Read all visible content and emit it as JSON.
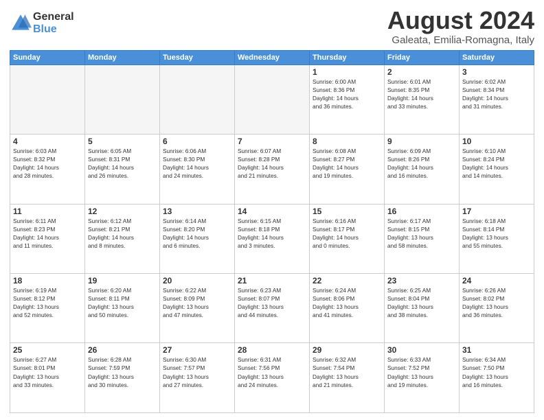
{
  "header": {
    "logo": {
      "general": "General",
      "blue": "Blue"
    },
    "title": "August 2024",
    "location": "Galeata, Emilia-Romagna, Italy"
  },
  "weekdays": [
    "Sunday",
    "Monday",
    "Tuesday",
    "Wednesday",
    "Thursday",
    "Friday",
    "Saturday"
  ],
  "weeks": [
    [
      {
        "day": "",
        "info": ""
      },
      {
        "day": "",
        "info": ""
      },
      {
        "day": "",
        "info": ""
      },
      {
        "day": "",
        "info": ""
      },
      {
        "day": "1",
        "info": "Sunrise: 6:00 AM\nSunset: 8:36 PM\nDaylight: 14 hours\nand 36 minutes."
      },
      {
        "day": "2",
        "info": "Sunrise: 6:01 AM\nSunset: 8:35 PM\nDaylight: 14 hours\nand 33 minutes."
      },
      {
        "day": "3",
        "info": "Sunrise: 6:02 AM\nSunset: 8:34 PM\nDaylight: 14 hours\nand 31 minutes."
      }
    ],
    [
      {
        "day": "4",
        "info": "Sunrise: 6:03 AM\nSunset: 8:32 PM\nDaylight: 14 hours\nand 28 minutes."
      },
      {
        "day": "5",
        "info": "Sunrise: 6:05 AM\nSunset: 8:31 PM\nDaylight: 14 hours\nand 26 minutes."
      },
      {
        "day": "6",
        "info": "Sunrise: 6:06 AM\nSunset: 8:30 PM\nDaylight: 14 hours\nand 24 minutes."
      },
      {
        "day": "7",
        "info": "Sunrise: 6:07 AM\nSunset: 8:28 PM\nDaylight: 14 hours\nand 21 minutes."
      },
      {
        "day": "8",
        "info": "Sunrise: 6:08 AM\nSunset: 8:27 PM\nDaylight: 14 hours\nand 19 minutes."
      },
      {
        "day": "9",
        "info": "Sunrise: 6:09 AM\nSunset: 8:26 PM\nDaylight: 14 hours\nand 16 minutes."
      },
      {
        "day": "10",
        "info": "Sunrise: 6:10 AM\nSunset: 8:24 PM\nDaylight: 14 hours\nand 14 minutes."
      }
    ],
    [
      {
        "day": "11",
        "info": "Sunrise: 6:11 AM\nSunset: 8:23 PM\nDaylight: 14 hours\nand 11 minutes."
      },
      {
        "day": "12",
        "info": "Sunrise: 6:12 AM\nSunset: 8:21 PM\nDaylight: 14 hours\nand 8 minutes."
      },
      {
        "day": "13",
        "info": "Sunrise: 6:14 AM\nSunset: 8:20 PM\nDaylight: 14 hours\nand 6 minutes."
      },
      {
        "day": "14",
        "info": "Sunrise: 6:15 AM\nSunset: 8:18 PM\nDaylight: 14 hours\nand 3 minutes."
      },
      {
        "day": "15",
        "info": "Sunrise: 6:16 AM\nSunset: 8:17 PM\nDaylight: 14 hours\nand 0 minutes."
      },
      {
        "day": "16",
        "info": "Sunrise: 6:17 AM\nSunset: 8:15 PM\nDaylight: 13 hours\nand 58 minutes."
      },
      {
        "day": "17",
        "info": "Sunrise: 6:18 AM\nSunset: 8:14 PM\nDaylight: 13 hours\nand 55 minutes."
      }
    ],
    [
      {
        "day": "18",
        "info": "Sunrise: 6:19 AM\nSunset: 8:12 PM\nDaylight: 13 hours\nand 52 minutes."
      },
      {
        "day": "19",
        "info": "Sunrise: 6:20 AM\nSunset: 8:11 PM\nDaylight: 13 hours\nand 50 minutes."
      },
      {
        "day": "20",
        "info": "Sunrise: 6:22 AM\nSunset: 8:09 PM\nDaylight: 13 hours\nand 47 minutes."
      },
      {
        "day": "21",
        "info": "Sunrise: 6:23 AM\nSunset: 8:07 PM\nDaylight: 13 hours\nand 44 minutes."
      },
      {
        "day": "22",
        "info": "Sunrise: 6:24 AM\nSunset: 8:06 PM\nDaylight: 13 hours\nand 41 minutes."
      },
      {
        "day": "23",
        "info": "Sunrise: 6:25 AM\nSunset: 8:04 PM\nDaylight: 13 hours\nand 38 minutes."
      },
      {
        "day": "24",
        "info": "Sunrise: 6:26 AM\nSunset: 8:02 PM\nDaylight: 13 hours\nand 36 minutes."
      }
    ],
    [
      {
        "day": "25",
        "info": "Sunrise: 6:27 AM\nSunset: 8:01 PM\nDaylight: 13 hours\nand 33 minutes."
      },
      {
        "day": "26",
        "info": "Sunrise: 6:28 AM\nSunset: 7:59 PM\nDaylight: 13 hours\nand 30 minutes."
      },
      {
        "day": "27",
        "info": "Sunrise: 6:30 AM\nSunset: 7:57 PM\nDaylight: 13 hours\nand 27 minutes."
      },
      {
        "day": "28",
        "info": "Sunrise: 6:31 AM\nSunset: 7:56 PM\nDaylight: 13 hours\nand 24 minutes."
      },
      {
        "day": "29",
        "info": "Sunrise: 6:32 AM\nSunset: 7:54 PM\nDaylight: 13 hours\nand 21 minutes."
      },
      {
        "day": "30",
        "info": "Sunrise: 6:33 AM\nSunset: 7:52 PM\nDaylight: 13 hours\nand 19 minutes."
      },
      {
        "day": "31",
        "info": "Sunrise: 6:34 AM\nSunset: 7:50 PM\nDaylight: 13 hours\nand 16 minutes."
      }
    ]
  ]
}
